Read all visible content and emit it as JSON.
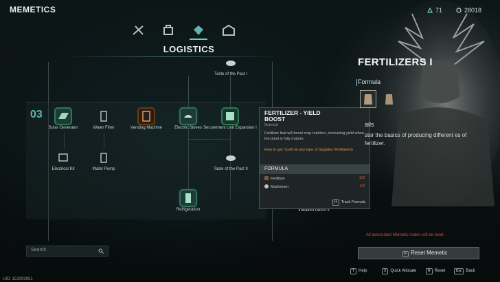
{
  "header": {
    "title": "MEMETICS",
    "currency1": "71",
    "currency2": "28018"
  },
  "category": "LOGISTICS",
  "tabs": [
    "combat-tab-icon",
    "crafting-tab-icon",
    "logistics-tab-icon",
    "building-tab-icon"
  ],
  "tier": "03",
  "nodes": {
    "taste1": "Taste of the Past I",
    "solar": "Solar Generator",
    "waterfilter": "Water Filter",
    "vending": "Vending Machine",
    "electricstoves": "Electric Stoves",
    "securement": "Securement Unit Expansion I",
    "electricalkit": "Electrical Kit",
    "waterpump": "Water Pump",
    "taste2": "Taste of the Past II",
    "refrigeration": "Refrigeration",
    "imitation": "Imitation Decor II"
  },
  "search": {
    "placeholder": "Search"
  },
  "uid": "UID: 151093951",
  "tooltip": {
    "title": "FERTILIZER - YIELD BOOST",
    "subtitle": "Materials",
    "description": "Fertilizer that will boost crop nutrition, increasing yield when the plant is fully mature.",
    "how_to_get": "How to get: Craft on any type of Supplies Workbench",
    "formula_header": "FORMULA",
    "ingredients": [
      {
        "name": "Fertilizer",
        "qty": "0/3"
      },
      {
        "name": "Mushroom",
        "qty": "1/3"
      }
    ],
    "track_key": "H",
    "track_label": "Track Formula"
  },
  "panel": {
    "title": "FERTILIZERS I",
    "formula_label": "Formula",
    "details_label": "ails",
    "description": "ster the basics of producing different es of fertilizer.",
    "warning": "All associated Memetic nodes will be reset.",
    "reset_key": "F",
    "reset_label": "Reset Memetic"
  },
  "hints": [
    {
      "key": "T",
      "label": "Help"
    },
    {
      "key": "X",
      "label": "Quick Allocate"
    },
    {
      "key": "R",
      "label": "Reset"
    },
    {
      "key": "Esc",
      "label": "Back"
    }
  ],
  "colors": {
    "accent": "#6fd0c8",
    "warning": "#c4513f",
    "quantity": "#d46a42",
    "how_to_get": "#d89a5a"
  }
}
